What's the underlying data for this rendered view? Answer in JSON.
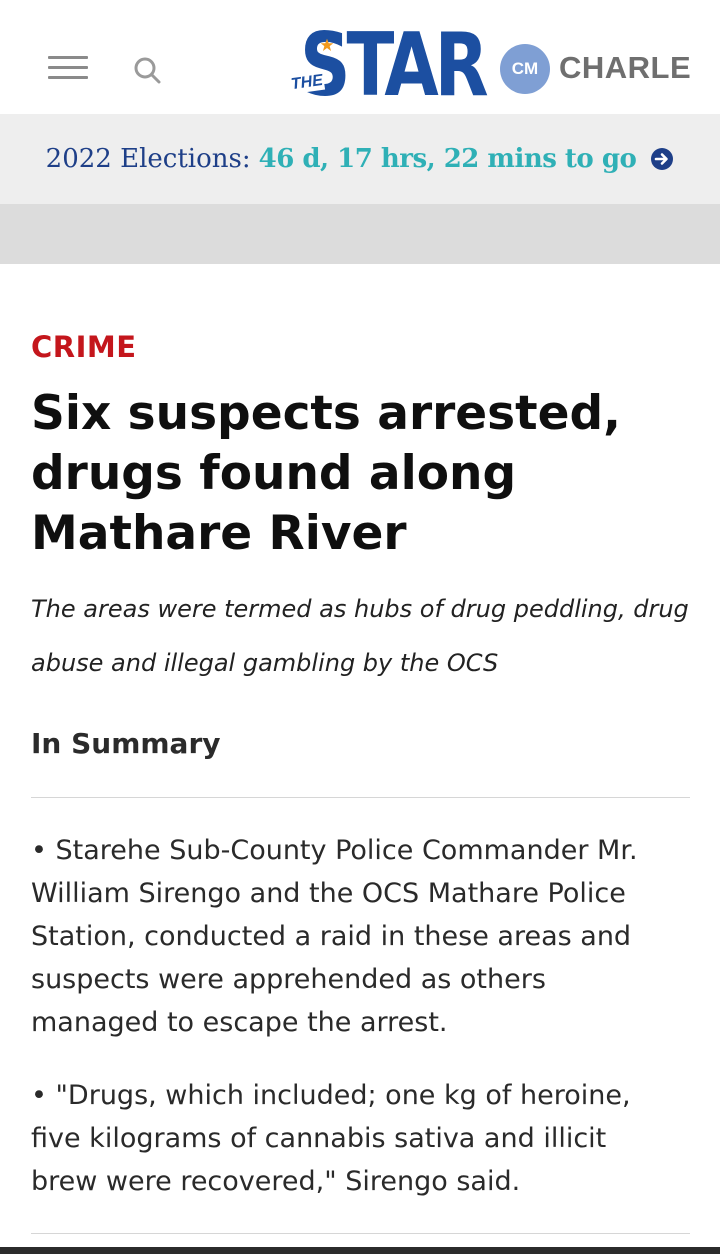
{
  "header": {
    "logo_prefix": "THE",
    "logo_text": "STAR",
    "avatar_initials": "CM",
    "user_name": "CHARLE",
    "brand_color": "#1c4fa1",
    "menu_icon": "hamburger-menu-icon",
    "search_icon": "search-icon"
  },
  "elections": {
    "label": "2022 Elections:",
    "countdown": "46 d, 17 hrs, 22 mins to go",
    "label_color": "#1e3f88",
    "countdown_color": "#2fb0b6",
    "arrow_icon": "arrow-circle-right-icon"
  },
  "article": {
    "category": "CRIME",
    "category_color": "#c4161c",
    "headline": "Six suspects arrested, drugs found along Mathare River",
    "standfirst": "The areas were termed as hubs of drug peddling, drug abuse and illegal gambling by the OCS",
    "summary_title": "In Summary",
    "summary_points": [
      "• Starehe Sub-County Police Commander Mr. William Sirengo and the OCS Mathare Police Station, conducted a raid in these areas and suspects were apprehended as others managed to escape the arrest.",
      "• \"Drugs, which included; one kg of heroine, five kilograms of cannabis sativa and illicit brew were recovered,\" Sirengo said."
    ]
  }
}
